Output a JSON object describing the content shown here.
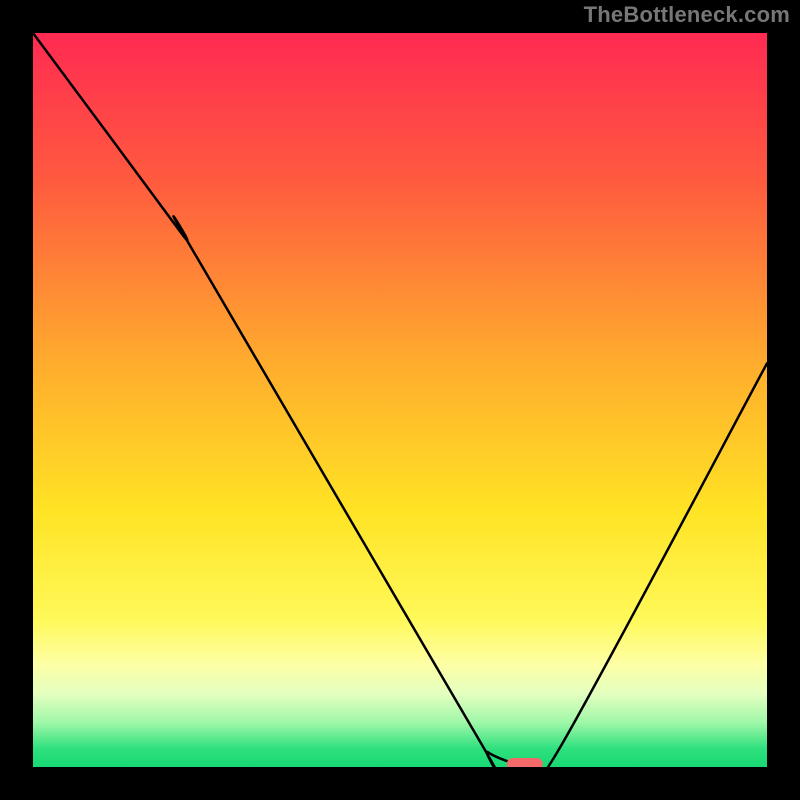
{
  "attribution": "TheBottleneck.com",
  "chart_data": {
    "type": "line",
    "title": "",
    "xlabel": "",
    "ylabel": "",
    "xlim": [
      0,
      100
    ],
    "ylim": [
      0,
      100
    ],
    "series": [
      {
        "name": "bottleneck-curve",
        "x": [
          0,
          20,
          22,
          60,
          62,
          67,
          68,
          72,
          100
        ],
        "values": [
          100,
          73,
          70,
          5,
          2,
          0,
          0,
          3,
          55
        ]
      }
    ],
    "annotations": [
      {
        "name": "optimal-marker",
        "type": "pill",
        "x": 67,
        "y": 0,
        "color": "#f46a6a"
      }
    ],
    "background": {
      "type": "vertical-gradient",
      "stops": [
        {
          "pos": 0.0,
          "color": "#ff2a52"
        },
        {
          "pos": 0.2,
          "color": "#ff5a3f"
        },
        {
          "pos": 0.45,
          "color": "#ffac2d"
        },
        {
          "pos": 0.65,
          "color": "#ffe324"
        },
        {
          "pos": 0.8,
          "color": "#fff95a"
        },
        {
          "pos": 0.86,
          "color": "#fdffa5"
        },
        {
          "pos": 0.9,
          "color": "#e4ffc0"
        },
        {
          "pos": 0.94,
          "color": "#9ef7a8"
        },
        {
          "pos": 0.975,
          "color": "#2fe07e"
        },
        {
          "pos": 1.0,
          "color": "#17d973"
        }
      ]
    }
  }
}
